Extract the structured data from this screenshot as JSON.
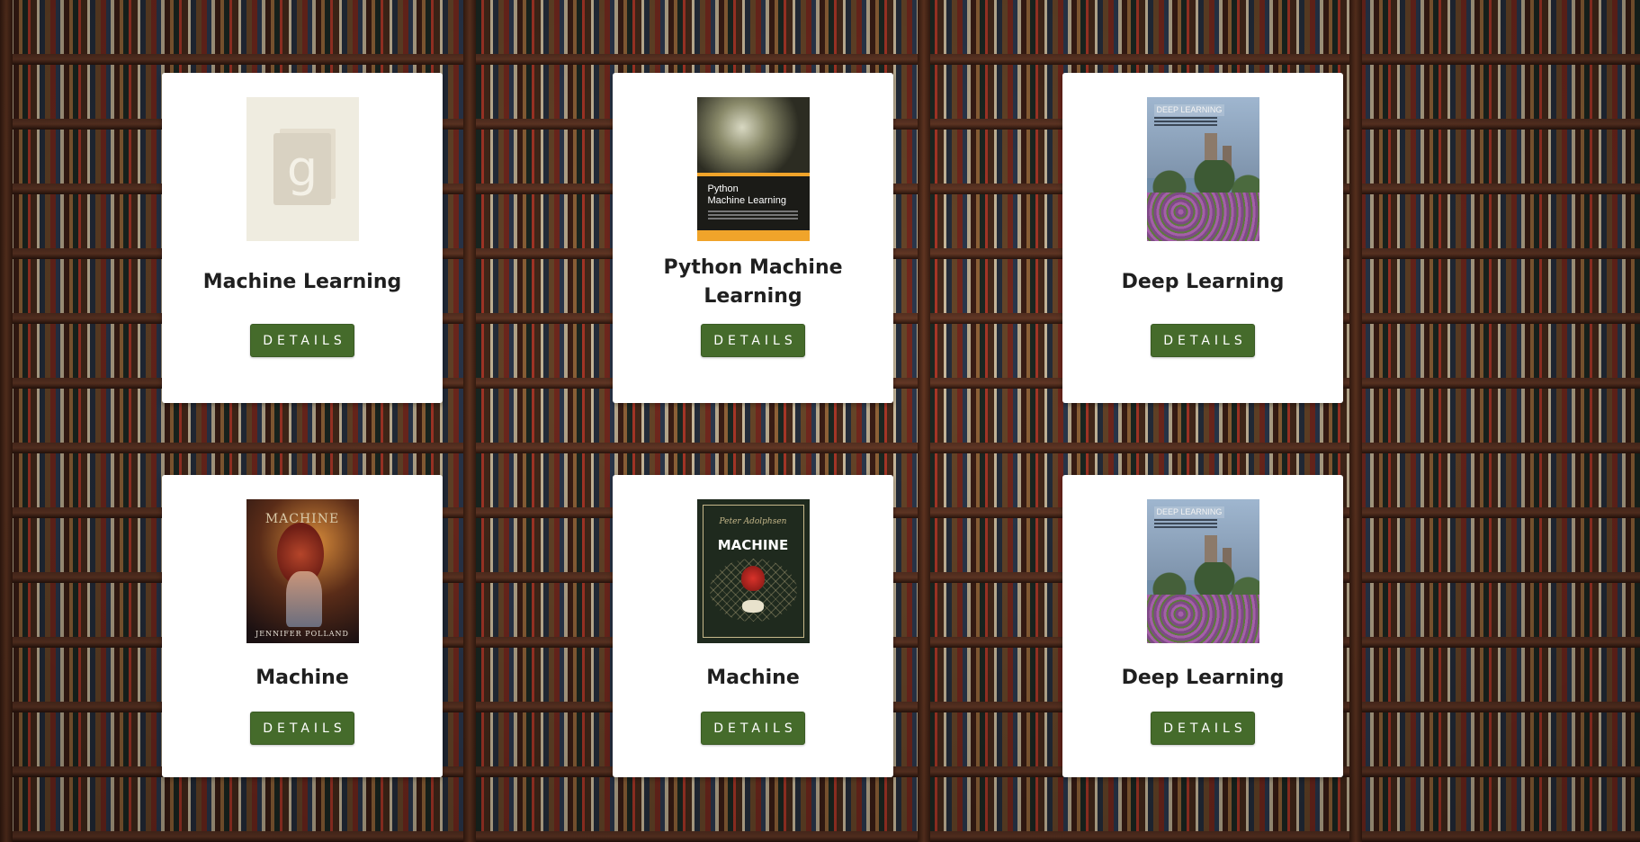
{
  "books": [
    {
      "title": "Machine Learning",
      "button_label": "DETAILS",
      "cover_style": "placeholder",
      "cover_text": "g"
    },
    {
      "title": "Python Machine Learning",
      "button_label": "DETAILS",
      "cover_style": "python",
      "cover_text": "Python\nMachine Learning"
    },
    {
      "title": "Deep Learning",
      "button_label": "DETAILS",
      "cover_style": "deep",
      "cover_text": "DEEP LEARNING"
    },
    {
      "title": "Machine",
      "button_label": "DETAILS",
      "cover_style": "machine-portrait",
      "cover_text": "MACHINE",
      "cover_author": "JENNIFER POLLAND"
    },
    {
      "title": "Machine",
      "button_label": "DETAILS",
      "cover_style": "machine-ornate",
      "cover_text": "MACHINE",
      "cover_author": "Peter Adolphsen"
    },
    {
      "title": "Deep Learning",
      "button_label": "DETAILS",
      "cover_style": "deep",
      "cover_text": "DEEP LEARNING"
    }
  ],
  "colors": {
    "button_bg": "#456b2b",
    "button_text": "#ffffff",
    "card_bg": "#ffffff",
    "title_text": "#1f1f1f"
  }
}
